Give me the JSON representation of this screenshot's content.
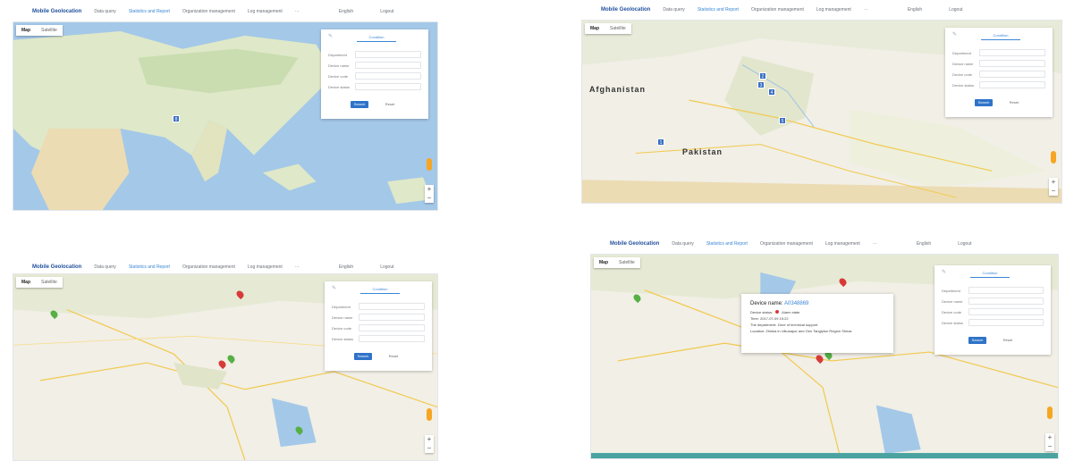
{
  "nav": {
    "brand": "Mobile Geolocation",
    "items": [
      "Data query",
      "Statistics and Report",
      "Organization management",
      "Log management",
      "···"
    ],
    "active_index": 1,
    "right": [
      "English",
      "Logout"
    ]
  },
  "map": {
    "type_tabs": [
      "Map",
      "Satellite"
    ],
    "zoom_in": "+",
    "zoom_out": "−"
  },
  "form": {
    "tab_label": "Condition",
    "edit_icon": "pencil-icon",
    "fields": [
      "Department",
      "Device name",
      "Device code",
      "Device status"
    ],
    "search_label": "Search",
    "reset_label": "Reset"
  },
  "panels": [
    {
      "id": "p1",
      "clusters": [
        {
          "label": "8"
        }
      ]
    },
    {
      "id": "p2",
      "region_labels": [
        "Afghanistan",
        "Pakistan"
      ],
      "clusters": [
        {
          "label": "2"
        },
        {
          "label": "3"
        },
        {
          "label": "4"
        },
        {
          "label": "5"
        },
        {
          "label": "1"
        }
      ]
    },
    {
      "id": "p3",
      "pins": [
        "red",
        "red",
        "green",
        "green",
        "green"
      ]
    },
    {
      "id": "p4",
      "popup": {
        "title_prefix": "Device name:",
        "title_value": "A0348869",
        "status_label": "Device status:",
        "status_value": "Alarm state",
        "time_line": "Time: 2017-07-09 15:22",
        "department_line": "The department: Zone of technical support",
        "location_line": "Location: Zhinka in Ulkusapor and Geo Tanglyton Region Shiraz"
      },
      "pins": [
        "red",
        "red",
        "green",
        "green"
      ]
    }
  ],
  "colors": {
    "brand": "#1f4f9c",
    "accent": "#3a86d6",
    "primary_button": "#2f73c8",
    "water": "#a4c8e8",
    "land": "#f1efe6",
    "alarm": "#d83a3a",
    "ok": "#56b044"
  }
}
